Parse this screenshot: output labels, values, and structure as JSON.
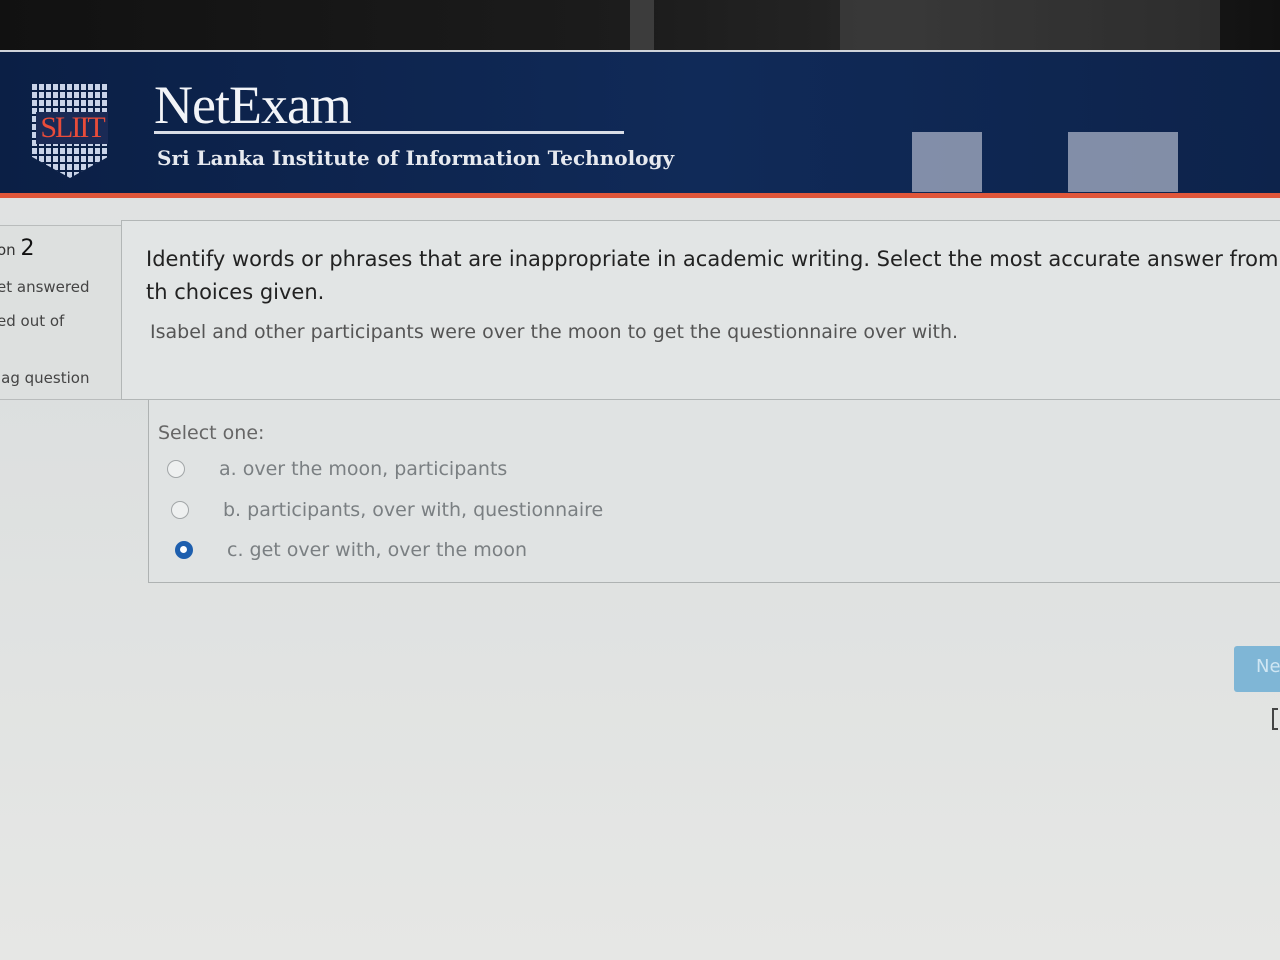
{
  "header": {
    "brand": "NetExam",
    "subtitle": "Sri Lanka Institute of Information Technology",
    "logo_text": "SLIIT"
  },
  "question_info": {
    "number_prefix": "on",
    "number": "2",
    "status": "et answered",
    "marks": "ed out of",
    "flag_label": "lag question"
  },
  "question": {
    "instruction": "Identify words or phrases that are inappropriate in academic writing. Select the most accurate answer from th choices given.",
    "sentence": "Isabel and other participants were over the moon to get the questionnaire over with.",
    "select_label": "Select one:",
    "options": [
      {
        "label": "a. over the moon, participants",
        "selected": false
      },
      {
        "label": "b. participants, over with, questionnaire",
        "selected": false
      },
      {
        "label": "c. get over with, over the moon",
        "selected": true
      }
    ]
  },
  "nav": {
    "next_label": "Ne"
  },
  "colors": {
    "header_bg": "#0d234b",
    "accent_line": "#e0563a",
    "radio_selected": "#1e5fae",
    "next_button": "#7fb6d6"
  }
}
